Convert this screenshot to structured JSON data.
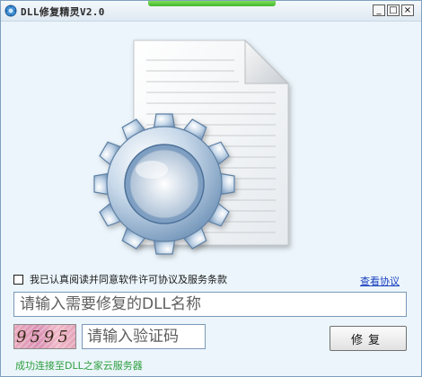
{
  "window": {
    "title": "DLL修复精灵V2.0",
    "accent_color": "#43b52b",
    "controls": {
      "minimize_glyph": "_",
      "maximize_glyph": "□",
      "close_glyph": "×"
    }
  },
  "hero": {
    "icon": "document-gear-icon"
  },
  "agreement": {
    "checked": false,
    "label": "我已认真阅读并同意软件许可协议及服务条款",
    "link": "查看协议"
  },
  "dll_input": {
    "value": "",
    "placeholder": "请输入需要修复的DLL名称"
  },
  "captcha": {
    "text": "9595"
  },
  "captcha_input": {
    "value": "",
    "placeholder": "请输入验证码"
  },
  "repair_button": {
    "label": "修复"
  },
  "status": {
    "text": "成功连接至DLL之家云服务器",
    "color": "#2f9e3e"
  }
}
